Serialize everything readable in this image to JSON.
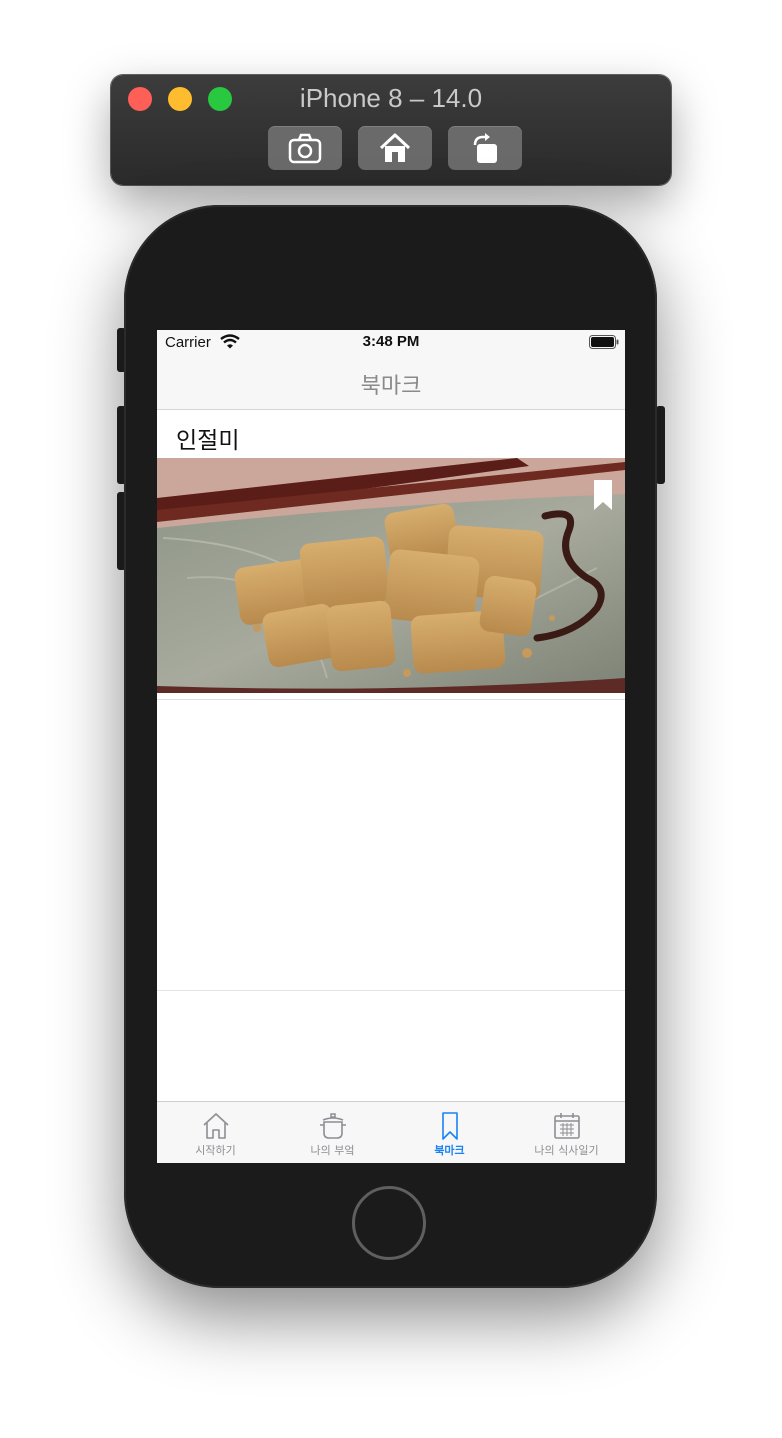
{
  "simulator": {
    "title": "iPhone 8 – 14.0",
    "toolbar": [
      {
        "label": "screenshot",
        "icon": "camera-icon"
      },
      {
        "label": "home",
        "icon": "home-icon"
      },
      {
        "label": "rotate",
        "icon": "rotate-icon"
      }
    ]
  },
  "status_bar": {
    "carrier": "Carrier",
    "time": "3:48 PM"
  },
  "nav": {
    "title": "북마크"
  },
  "bookmarks": [
    {
      "title": "인절미",
      "image": "injeolmi-rice-cake-photo",
      "bookmarked": true
    }
  ],
  "tabs": [
    {
      "label": "시작하기",
      "icon": "house-icon",
      "active": false
    },
    {
      "label": "나의 부엌",
      "icon": "pot-icon",
      "active": false
    },
    {
      "label": "북마크",
      "icon": "bookmark-icon",
      "active": true
    },
    {
      "label": "나의 식사일기",
      "icon": "calendar-icon",
      "active": false
    }
  ],
  "colors": {
    "accent": "#1a82f7",
    "tab_inactive": "#8e8e93",
    "window_close": "#fe5f57",
    "window_minimize": "#febc2e",
    "window_zoom": "#28c840"
  }
}
